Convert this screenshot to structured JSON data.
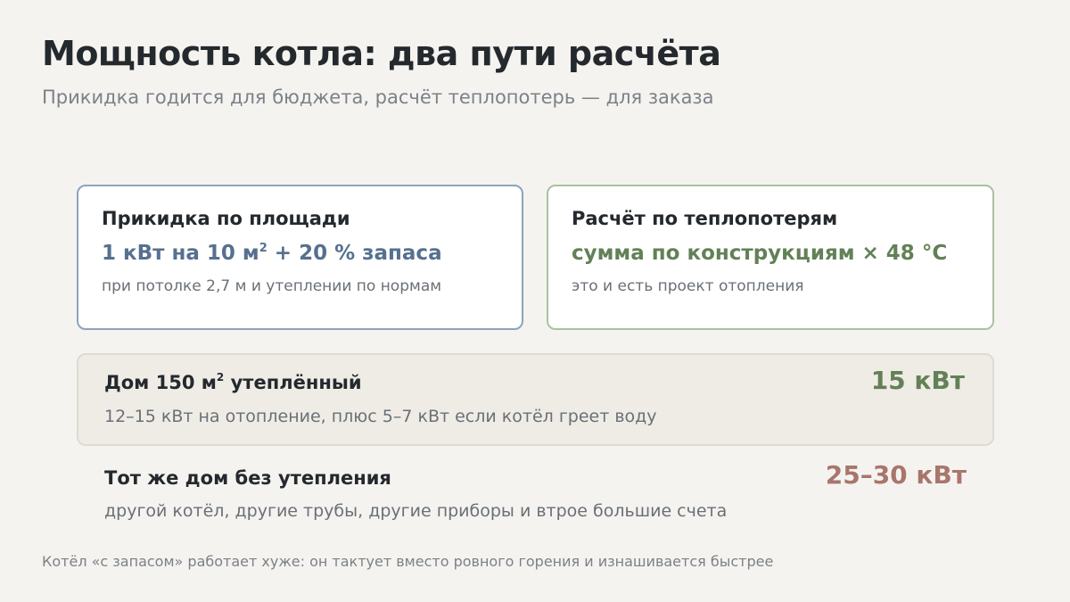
{
  "title": "Мощность котла: два пути расчёта",
  "subtitle": "Прикидка годится для бюджета, расчёт теплопотерь — для заказа",
  "cards": [
    {
      "title": "Прикидка по площади",
      "formula_before": "1 кВт на 10 м",
      "formula_sup": "2",
      "formula_after": " + 20 % запаса",
      "note": "при потолке 2,7 м и утеплении по нормам",
      "border_color": "#8da3bd",
      "accent_color": "#56708f"
    },
    {
      "title": "Расчёт по теплопотерям",
      "formula": "сумма по конструкциям × 48 °C",
      "note": "это и есть проект отопления",
      "border_color": "#a9c2a0",
      "accent_color": "#628156"
    }
  ],
  "rows": [
    {
      "title_before": "Дом 150 м",
      "title_sup": "2",
      "title_after": " утеплённый",
      "note": "12–15 кВт на отопление, плюс 5–7 кВт если котёл греет воду",
      "value": "15 кВт",
      "value_color": "#628156"
    },
    {
      "title": "Тот же дом без утепления",
      "note": "другой котёл, другие трубы, другие приборы и втрое большие счета",
      "value": "25–30 кВт",
      "value_color": "#a8766c"
    }
  ],
  "footnote": "Котёл «с запасом» работает хуже: он тактует вместо ровного горения и изнашивается быстрее"
}
